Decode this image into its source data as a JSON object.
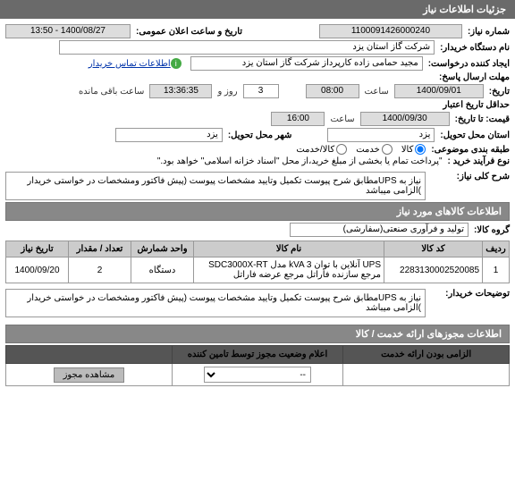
{
  "header": "جزئیات اطلاعات نیاز",
  "labels": {
    "need_no": "شماره نیاز:",
    "public_date": "تاریخ و ساعت اعلان عمومی:",
    "device_name": "نام دستگاه خریدار:",
    "requester": "ایجاد کننده درخواست:",
    "contact_link": "اطلاعات تماس خریدار",
    "deadline": "مهلت ارسال پاسخ:",
    "date": "تاریخ:",
    "time": "ساعت",
    "days": "روز و",
    "remain": "ساعت باقی مانده",
    "valid_from": "حداقل تاریخ اعتبار",
    "price_until": "قیمت: تا تاریخ:",
    "delivery_province": "استان محل تحویل:",
    "delivery_city": "شهر محل تحویل:",
    "category": "طبقه بندی موضوعی:",
    "purchase_type": "نوع فرآیند خرید :",
    "need_desc": "شرح کلی نیاز:",
    "items_info": "اطلاعات کالاهای مورد نیاز",
    "item_group": "گروه کالا:",
    "buyer_notes": "توضیحات خریدار:",
    "permits_header": "اطلاعات مجوزهای ارائه خدمت / کالا",
    "mandatory": "الزامی بودن ارائه خدمت",
    "status": "اعلام وضعیت مجوز توسط تامین کننده"
  },
  "values": {
    "need_no": "1100091426000240",
    "public_date": "1400/08/27 - 13:50",
    "device_name": "شرکت گاز استان یزد",
    "requester": "مجید حمامی زاده کارپرداز شرکت گاز استان یزد",
    "deadline_date": "1400/09/01",
    "deadline_time": "08:00",
    "days_remain": "3",
    "time_remain": "13:36:35",
    "valid_date": "1400/09/30",
    "valid_time": "16:00",
    "province": "یزد",
    "city": "یزد",
    "radio_goods": "کالا",
    "radio_service": "خدمت",
    "radio_both": "کالا/خدمت",
    "payment_note": "\"پرداخت تمام یا بخشی از مبلغ خرید،از محل \"اسناد خزانه اسلامی\" خواهد بود.\"",
    "need_desc_text": "نیاز به UPSمطابق شرح پیوست تکمیل وتایید مشخصات پیوست (پیش فاکتور ومشخصات در خواستی خریدار )الزامی میباشد",
    "item_group_text": "تولید و فرآوری صنعتی(سفارشی)",
    "buyer_notes_text": "نیاز به UPSمطابق شرح پیوست تکمیل وتایید مشخصات پیوست (پیش فاکتور ومشخصات در خواستی خریدار )الزامی میباشد",
    "select_option": "--",
    "view_permit": "مشاهده مجوز"
  },
  "table_headers": {
    "row": "ردیف",
    "code": "کد کالا",
    "name": "نام کالا",
    "unit": "واحد شمارش",
    "qty": "تعداد / مقدار",
    "need_date": "تاریخ نیاز"
  },
  "table_rows": [
    {
      "row": "1",
      "code": "2283130002520085",
      "name": "UPS آنلاین با توان kVA 3 مدل SDC3000X-RT مرجع سازنده فاراتل مرجع عرضه فاراتل",
      "unit": "دستگاه",
      "qty": "2",
      "need_date": "1400/09/20"
    }
  ]
}
